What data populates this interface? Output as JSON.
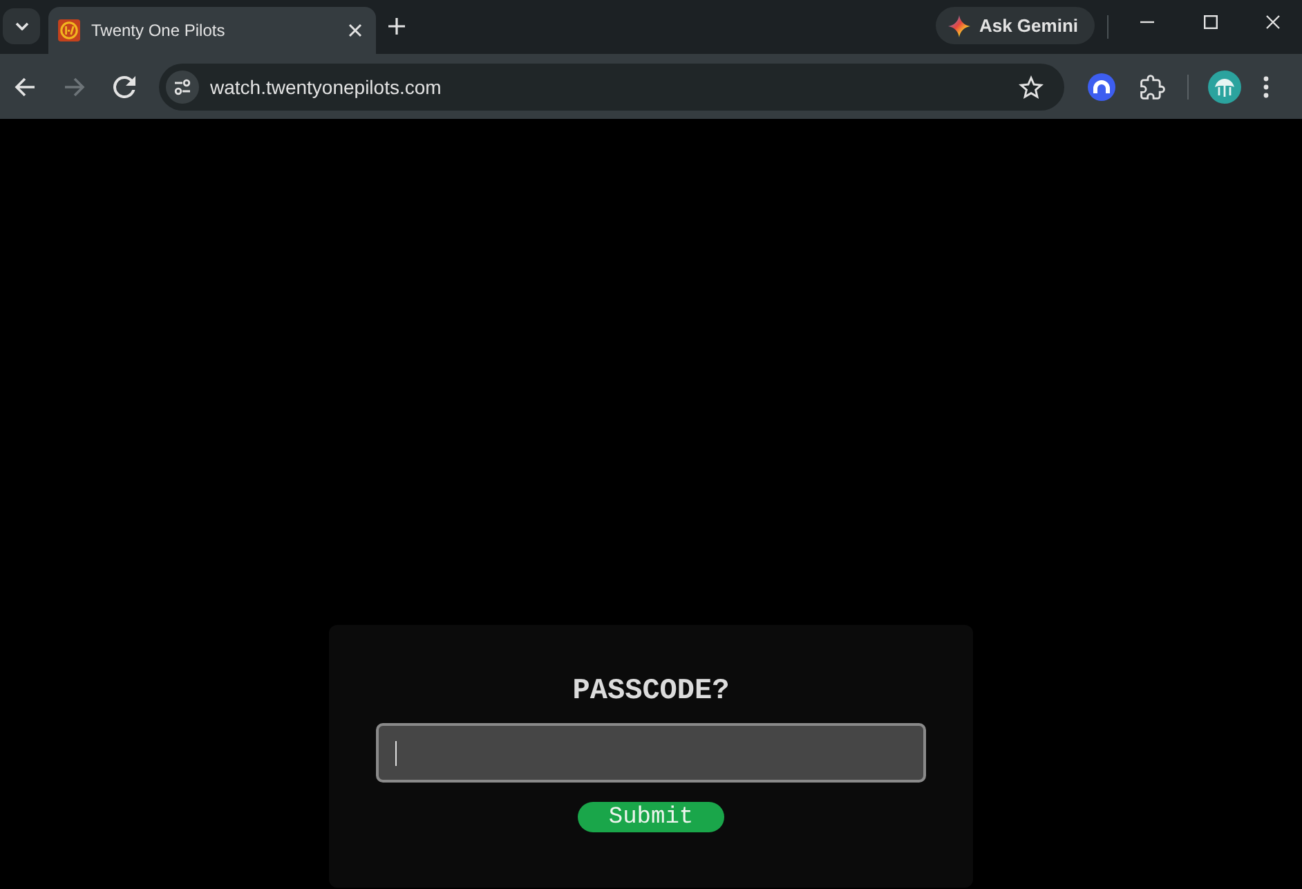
{
  "tabs": [
    {
      "title": "Twenty One Pilots",
      "selected": true
    }
  ],
  "gemini_button": {
    "label": "Ask Gemini"
  },
  "nav_buttons": [
    {
      "kind": "back",
      "disabled": false
    },
    {
      "kind": "forward",
      "disabled": true
    },
    {
      "kind": "reload",
      "disabled": false
    }
  ],
  "address_bar": {
    "url": "watch.twentyonepilots.com"
  },
  "passcode_form": {
    "title": "PASSCODE?",
    "field": {
      "focused": true
    },
    "submit_label": "Submit"
  }
}
